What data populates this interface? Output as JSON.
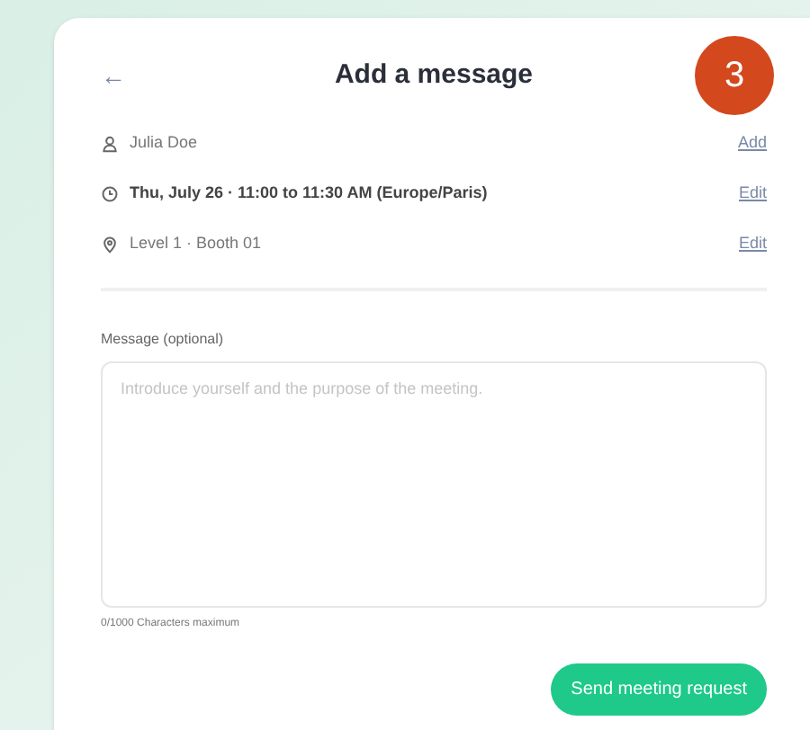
{
  "header": {
    "back": "←",
    "title": "Add a message"
  },
  "badge": "3",
  "details": [
    {
      "kind": "person",
      "text": "Julia Doe",
      "emphasized": false,
      "action": "Add"
    },
    {
      "kind": "time",
      "text": "Thu, July 26 · 11:00 to 11:30 AM (Europe/Paris)",
      "emphasized": true,
      "action": "Edit"
    },
    {
      "kind": "place",
      "text": "Level 1 · Booth 01",
      "emphasized": false,
      "action": "Edit"
    }
  ],
  "message": {
    "label": "Message (optional)",
    "placeholder": "Introduce yourself and the purpose of the meeting.",
    "counter": "0/1000 Characters maximum"
  },
  "submit": "Send meeting request"
}
